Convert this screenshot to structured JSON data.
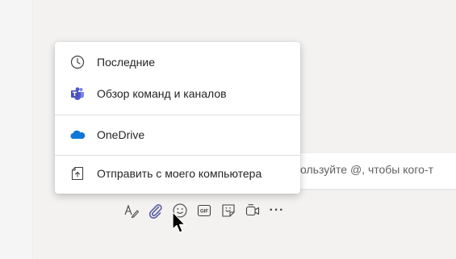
{
  "menu": {
    "items": [
      {
        "label": "Последние",
        "icon": "clock-icon"
      },
      {
        "label": "Обзор команд и каналов",
        "icon": "teams-icon"
      },
      {
        "label": "OneDrive",
        "icon": "onedrive-cloud-icon"
      },
      {
        "label": "Отправить с моего компьютера",
        "icon": "upload-icon"
      }
    ]
  },
  "compose": {
    "placeholder": "ользуйте @, чтобы кого-т"
  },
  "toolbar": {
    "icons": [
      "format-icon",
      "attach-icon",
      "emoji-icon",
      "gif-icon",
      "sticker-icon",
      "meet-now-icon",
      "more-options-icon"
    ],
    "gif_text": "GIF",
    "more_text": "···"
  },
  "colors": {
    "accent": "#6264a7",
    "onedrive": "#0f78d4",
    "menu_background": "#ffffff",
    "page_background": "#f3f2f1"
  }
}
